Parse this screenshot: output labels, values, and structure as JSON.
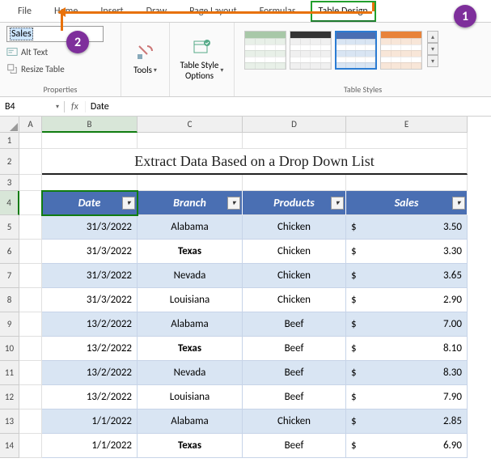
{
  "ribbon": {
    "tabs": [
      "File",
      "Home",
      "Insert",
      "Draw",
      "Page Layout",
      "Formulas",
      "Table Design"
    ],
    "active_tab": "Table Design",
    "table_name_value": "Sales",
    "alt_text": "Alt Text",
    "resize_table": "Resize Table",
    "group_properties": "Properties",
    "tools_label": "Tools",
    "tso_label": "Table Style\nOptions",
    "styles_label": "Table Styles"
  },
  "badges": {
    "b1": "1",
    "b2": "2"
  },
  "formula_bar": {
    "name_box": "B4",
    "fx": "fx",
    "value": "Date"
  },
  "columns": [
    "A",
    "B",
    "C",
    "D",
    "E"
  ],
  "rows": [
    "1",
    "2",
    "3",
    "4",
    "5",
    "6",
    "7",
    "8",
    "9",
    "10",
    "11",
    "12",
    "13",
    "14"
  ],
  "title": "Extract Data Based on a Drop Down List",
  "table": {
    "headers": [
      "Date",
      "Branch",
      "Products",
      "Sales"
    ],
    "rows": [
      {
        "date": "31/3/2022",
        "branch": "Alabama",
        "product": "Chicken",
        "cur": "$",
        "sales": "3.50",
        "bold": false
      },
      {
        "date": "31/3/2022",
        "branch": "Texas",
        "product": "Chicken",
        "cur": "$",
        "sales": "3.30",
        "bold": true
      },
      {
        "date": "31/3/2022",
        "branch": "Nevada",
        "product": "Chicken",
        "cur": "$",
        "sales": "3.65",
        "bold": false
      },
      {
        "date": "31/3/2022",
        "branch": "Louisiana",
        "product": "Chicken",
        "cur": "$",
        "sales": "2.90",
        "bold": false
      },
      {
        "date": "13/2/2022",
        "branch": "Alabama",
        "product": "Beef",
        "cur": "$",
        "sales": "7.00",
        "bold": false
      },
      {
        "date": "13/2/2022",
        "branch": "Texas",
        "product": "Beef",
        "cur": "$",
        "sales": "8.10",
        "bold": true
      },
      {
        "date": "13/2/2022",
        "branch": "Nevada",
        "product": "Beef",
        "cur": "$",
        "sales": "8.30",
        "bold": false
      },
      {
        "date": "13/2/2022",
        "branch": "Louisiana",
        "product": "Beef",
        "cur": "$",
        "sales": "7.90",
        "bold": false
      },
      {
        "date": "1/1/2022",
        "branch": "Alabama",
        "product": "Chicken",
        "cur": "$",
        "sales": "2.85",
        "bold": false
      },
      {
        "date": "1/1/2022",
        "branch": "Texas",
        "product": "Beef",
        "cur": "$",
        "sales": "6.90",
        "bold": true
      }
    ]
  },
  "style_swatches": [
    {
      "hdr": "#a8c8a8",
      "body": "#e8f0e8"
    },
    {
      "hdr": "#333333",
      "body": "#f0f0f0"
    },
    {
      "hdr": "#4a6fb3",
      "body": "#d9e5f3",
      "selected": true
    },
    {
      "hdr": "#e8833a",
      "body": "#f8e6d8"
    }
  ]
}
